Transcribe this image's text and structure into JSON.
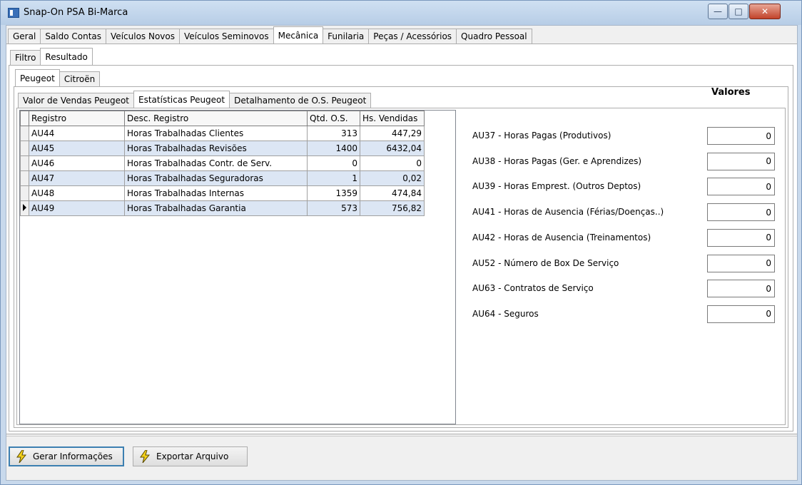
{
  "window": {
    "title": "Snap-On PSA Bi-Marca"
  },
  "main_tabs": [
    "Geral",
    "Saldo Contas",
    "Veículos Novos",
    "Veículos Seminovos",
    "Mecânica",
    "Funilaria",
    "Peças / Acessórios",
    "Quadro Pessoal"
  ],
  "main_tab_active": "Mecânica",
  "sub_tabs": [
    "Filtro",
    "Resultado"
  ],
  "sub_tab_active": "Resultado",
  "brand_tabs": [
    "Peugeot",
    "Citroën"
  ],
  "brand_tab_active": "Peugeot",
  "detail_tabs": [
    "Valor de Vendas Peugeot",
    "Estatísticas Peugeot",
    "Detalhamento de O.S. Peugeot"
  ],
  "detail_tab_active": "Estatísticas Peugeot",
  "grid": {
    "columns": [
      "Registro",
      "Desc. Registro",
      "Qtd. O.S.",
      "Hs. Vendidas"
    ],
    "rows": [
      [
        "AU44",
        "Horas Trabalhadas Clientes",
        "313",
        "447,29"
      ],
      [
        "AU45",
        "Horas Trabalhadas Revisões",
        "1400",
        "6432,04"
      ],
      [
        "AU46",
        "Horas Trabalhadas Contr. de Serv.",
        "0",
        "0"
      ],
      [
        "AU47",
        "Horas Trabalhadas Seguradoras",
        "1",
        "0,02"
      ],
      [
        "AU48",
        "Horas Trabalhadas Internas",
        "1359",
        "474,84"
      ],
      [
        "AU49",
        "Horas Trabalhadas Garantia",
        "573",
        "756,82"
      ]
    ],
    "current_row": 5
  },
  "values": {
    "header": "Valores",
    "items": [
      {
        "label": "AU37 - Horas Pagas (Produtivos)",
        "value": "0"
      },
      {
        "label": "AU38 - Horas Pagas (Ger. e Aprendizes)",
        "value": "0"
      },
      {
        "label": "AU39 - Horas Emprest. (Outros Deptos)",
        "value": "0"
      },
      {
        "label": "AU41 - Horas de Ausencia (Férias/Doenças..)",
        "value": "0"
      },
      {
        "label": "AU42 - Horas de Ausencia (Treinamentos)",
        "value": "0"
      },
      {
        "label": "AU52 - Número de Box De Serviço",
        "value": "0"
      },
      {
        "label": "AU63 - Contratos de Serviço",
        "value": "0"
      },
      {
        "label": "AU64 - Seguros",
        "value": "0"
      }
    ]
  },
  "buttons": {
    "generate": "Gerar Informações",
    "export": "Exportar Arquivo"
  },
  "icons": {
    "window": "app-icon",
    "button": "lightning-bolt-icon"
  },
  "colors": {
    "selected_row": "#dce6f4",
    "focus_border": "#3c7fb1",
    "bolt": "#f5d21b"
  }
}
